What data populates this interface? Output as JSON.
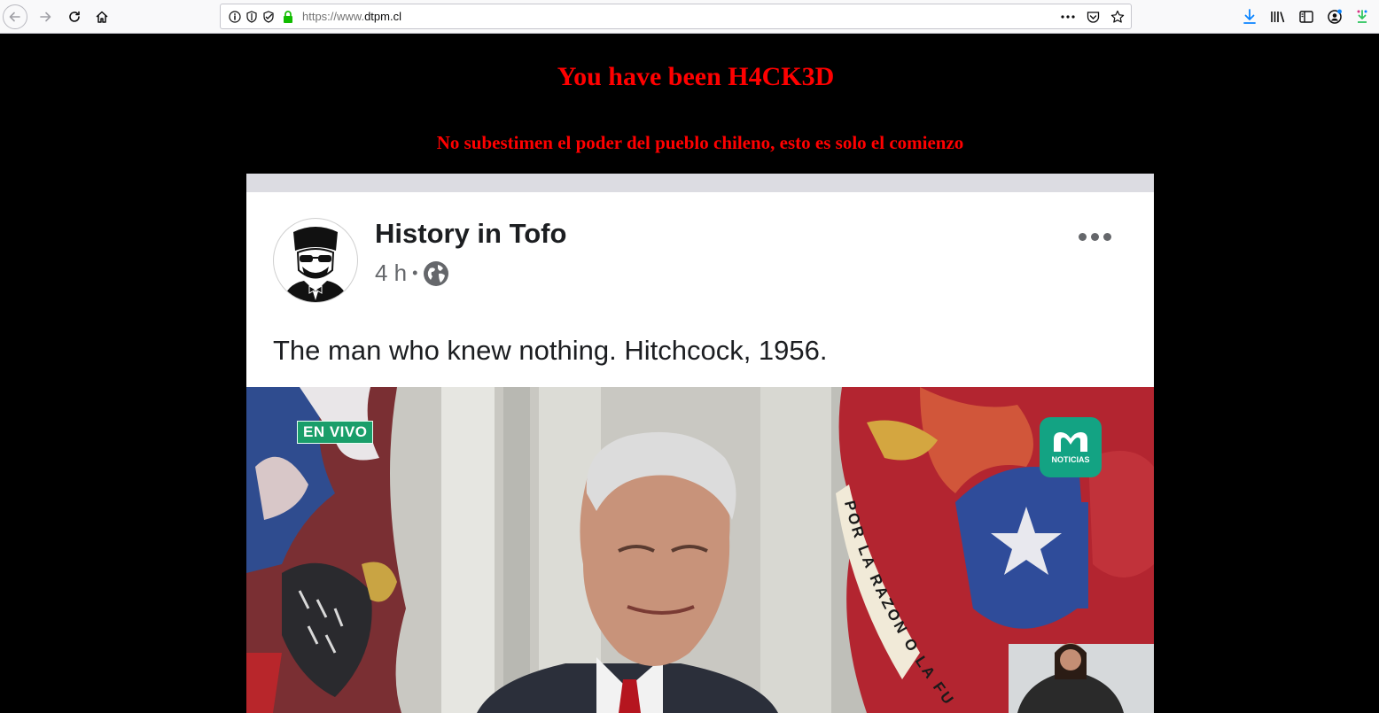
{
  "browser": {
    "url_prefix": "https://www.",
    "url_host": "dtpm.cl"
  },
  "page": {
    "title": "You have been H4CK3D",
    "subtitle": "No subestimen el poder del pueblo chileno, esto es solo el comienzo"
  },
  "post": {
    "page_name": "History in Tofo",
    "time": "4 h",
    "separator": "•",
    "caption": "The man who knew nothing. Hitchcock, 1956.",
    "live_badge": "EN VIVO",
    "news_logo_label": "NOTICIAS",
    "flag_text": "POR LA RAZON O LA FU",
    "icons": [
      "globe-icon",
      "more-options-icon"
    ]
  },
  "colors": {
    "background": "#000000",
    "hack_text": "#ff0000",
    "live_badge": "#1a9e6a",
    "news_logo": "#13a383"
  }
}
